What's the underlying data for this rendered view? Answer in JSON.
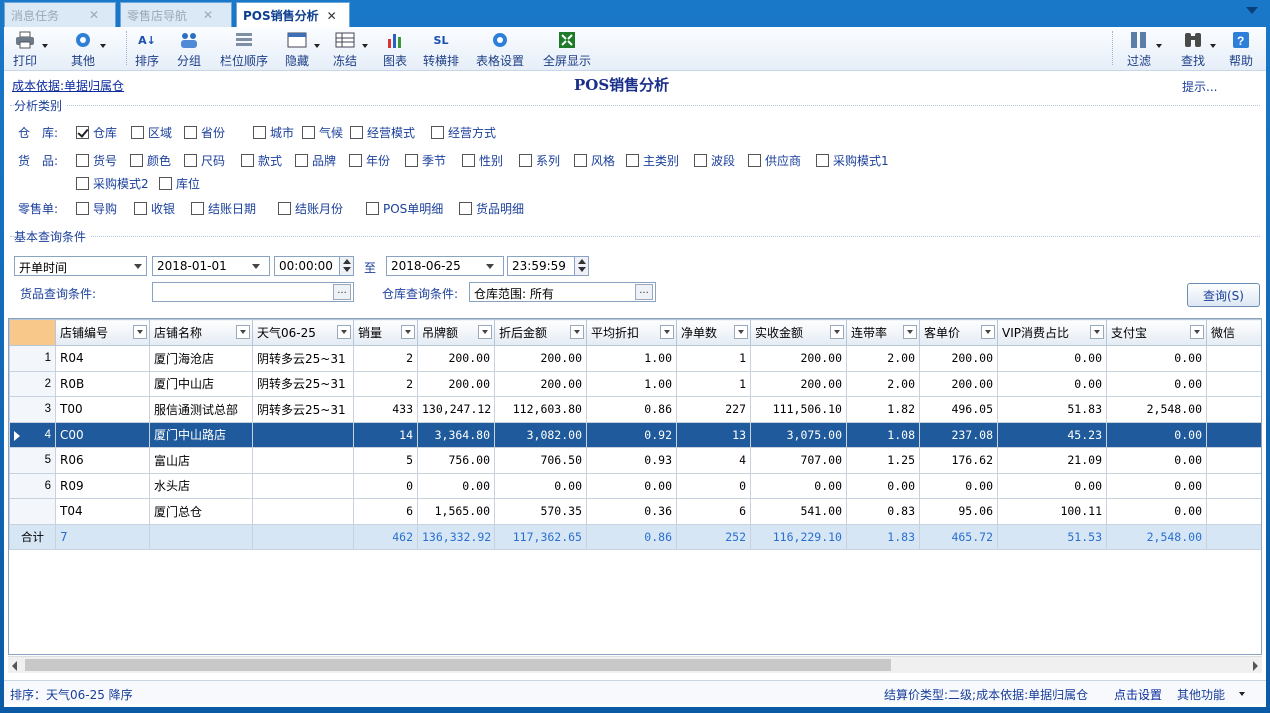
{
  "tabs": [
    {
      "label": "消息任务"
    },
    {
      "label": "零售店导航"
    },
    {
      "label": "POS销售分析"
    }
  ],
  "toolbar": {
    "print": "打印",
    "other": "其他",
    "sort": "排序",
    "group": "分组",
    "column_order": "栏位顺序",
    "hide": "隐藏",
    "freeze": "冻结",
    "chart": "图表",
    "pivot": "转横排",
    "table_settings": "表格设置",
    "fullscreen": "全屏显示",
    "filter": "过滤",
    "find": "查找",
    "help": "帮助"
  },
  "header": {
    "cost_link": "成本依据:单据归属仓",
    "title": "POS销售分析",
    "hint": "提示..."
  },
  "analysis": {
    "group_title": "分析类别",
    "warehouse_label": "仓　库:",
    "warehouse_items": [
      {
        "label": "仓库",
        "checked": true
      },
      {
        "label": "区域",
        "checked": false
      },
      {
        "label": "省份",
        "checked": false
      },
      {
        "label": "城市",
        "checked": false
      },
      {
        "label": "气候",
        "checked": false
      },
      {
        "label": "经营模式",
        "checked": false
      },
      {
        "label": "经营方式",
        "checked": false
      }
    ],
    "goods_label": "货　品:",
    "goods_items": [
      {
        "label": "货号"
      },
      {
        "label": "颜色"
      },
      {
        "label": "尺码"
      },
      {
        "label": "款式"
      },
      {
        "label": "品牌"
      },
      {
        "label": "年份"
      },
      {
        "label": "季节"
      },
      {
        "label": "性别"
      },
      {
        "label": "系列"
      },
      {
        "label": "风格"
      },
      {
        "label": "主类别"
      },
      {
        "label": "波段"
      },
      {
        "label": "供应商"
      },
      {
        "label": "采购模式1"
      },
      {
        "label": "采购模式2"
      },
      {
        "label": "库位"
      }
    ],
    "retail_label": "零售单:",
    "retail_items": [
      {
        "label": "导购"
      },
      {
        "label": "收银"
      },
      {
        "label": "结账日期"
      },
      {
        "label": "结账月份"
      },
      {
        "label": "POS单明细"
      },
      {
        "label": "货品明细"
      }
    ]
  },
  "query": {
    "group_title": "基本查询条件",
    "time_type": "开单时间",
    "date_from": "2018-01-01",
    "time_from": "00:00:00",
    "to_label": "至",
    "date_to": "2018-06-25",
    "time_to": "23:59:59",
    "goods_cond_label": "货品查询条件:",
    "goods_cond_value": "",
    "wh_cond_label": "仓库查询条件:",
    "wh_cond_value": "仓库范围: 所有",
    "query_button": "查询(S)"
  },
  "grid": {
    "columns": [
      "",
      "店铺编号",
      "店铺名称",
      "天气06-25",
      "销量",
      "吊牌额",
      "折后金额",
      "平均折扣",
      "净单数",
      "实收金额",
      "连带率",
      "客单价",
      "VIP消费占比",
      "支付宝",
      "微信"
    ],
    "rows": [
      [
        "1",
        "R04",
        "厦门海沧店",
        "阴转多云25~31",
        "2",
        "200.00",
        "200.00",
        "1.00",
        "1",
        "200.00",
        "2.00",
        "200.00",
        "0.00",
        "0.00",
        ""
      ],
      [
        "2",
        "R0B",
        "厦门中山店",
        "阴转多云25~31",
        "2",
        "200.00",
        "200.00",
        "1.00",
        "1",
        "200.00",
        "2.00",
        "200.00",
        "0.00",
        "0.00",
        ""
      ],
      [
        "3",
        "T00",
        "服信通测试总部",
        "阴转多云25~31",
        "433",
        "130,247.12",
        "112,603.80",
        "0.86",
        "227",
        "111,506.10",
        "1.82",
        "496.05",
        "51.83",
        "2,548.00",
        ""
      ],
      [
        "4",
        "C00",
        "厦门中山路店",
        "",
        "14",
        "3,364.80",
        "3,082.00",
        "0.92",
        "13",
        "3,075.00",
        "1.08",
        "237.08",
        "45.23",
        "0.00",
        ""
      ],
      [
        "5",
        "R06",
        "富山店",
        "",
        "5",
        "756.00",
        "706.50",
        "0.93",
        "4",
        "707.00",
        "1.25",
        "176.62",
        "21.09",
        "0.00",
        ""
      ],
      [
        "6",
        "R09",
        "水头店",
        "",
        "0",
        "0.00",
        "0.00",
        "0.00",
        "0",
        "0.00",
        "0.00",
        "0.00",
        "0.00",
        "0.00",
        ""
      ],
      [
        "",
        "T04",
        "厦门总仓",
        "",
        "6",
        "1,565.00",
        "570.35",
        "0.36",
        "6",
        "541.00",
        "0.83",
        "95.06",
        "100.11",
        "0.00",
        ""
      ]
    ],
    "selected_row": 3,
    "total": [
      "合计",
      "7",
      "",
      "",
      "462",
      "136,332.92",
      "117,362.65",
      "0.86",
      "252",
      "116,229.10",
      "1.83",
      "465.72",
      "51.53",
      "2,548.00",
      ""
    ]
  },
  "status": {
    "sort_info": "排序：天气06-25 降序",
    "price_info": "结算价类型:二级;成本依据:单据归属仓",
    "settings_link": "点击设置",
    "more": "其他功能"
  }
}
